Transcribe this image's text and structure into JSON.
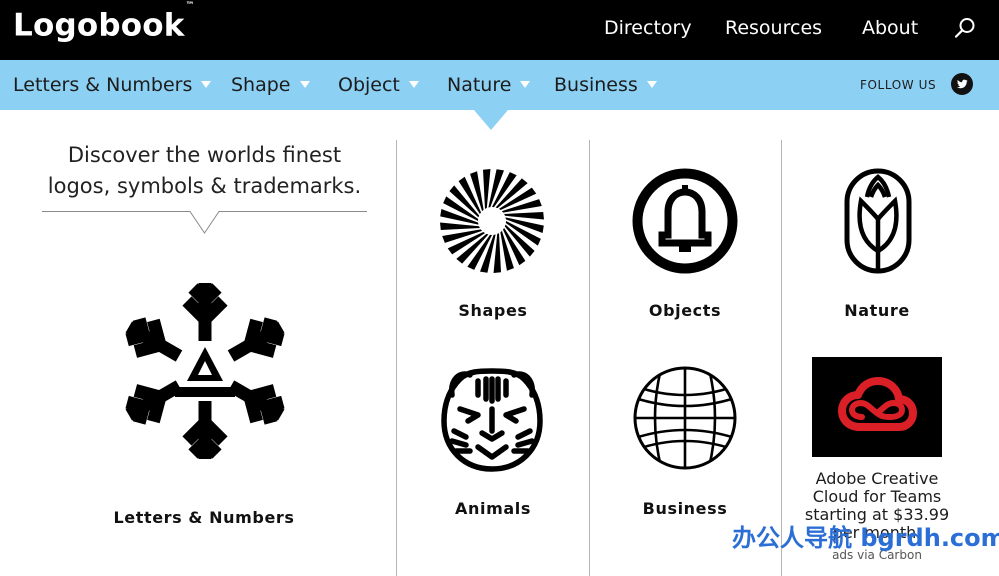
{
  "header": {
    "logo_text": "Logobook",
    "logo_tm": "™",
    "nav": [
      "Directory",
      "Resources",
      "About"
    ],
    "search_icon": "search-icon"
  },
  "categories": {
    "items": [
      "Letters & Numbers",
      "Shape",
      "Object",
      "Nature",
      "Business"
    ],
    "follow_label": "FOLLOW US",
    "social_icon": "twitter-icon"
  },
  "intro": {
    "line1": "Discover the worlds finest",
    "line2": "logos, symbols & trademarks."
  },
  "featured": {
    "label": "Letters & Numbers",
    "icon": "snowflake-a-icon"
  },
  "tiles": [
    {
      "label": "Shapes",
      "icon": "sunburst-icon"
    },
    {
      "label": "Objects",
      "icon": "bell-icon"
    },
    {
      "label": "Nature",
      "icon": "tulip-icon"
    },
    {
      "label": "Animals",
      "icon": "tiger-icon"
    },
    {
      "label": "Business",
      "icon": "globe-icon"
    }
  ],
  "ad": {
    "line1": "Adobe Creative",
    "line2": "Cloud for Teams",
    "line3": "starting at $33.99",
    "line4": "per month.",
    "via": "ads via Carbon",
    "icon": "creative-cloud-icon"
  },
  "watermark": "办公人导航 bgrdh.com",
  "colors": {
    "topbar": "#000000",
    "category_bar": "#8cd0f3",
    "ad_red": "#da1f26",
    "watermark": "#2b6fd6"
  }
}
